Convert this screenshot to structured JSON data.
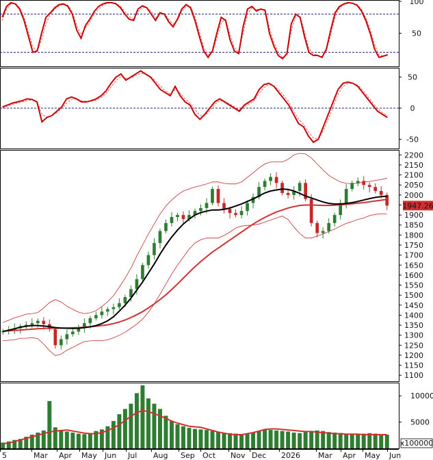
{
  "chart_data": [
    {
      "type": "line",
      "panel": "stochastic",
      "y_ticks": [
        "100",
        "50"
      ],
      "ylim": [
        0,
        100
      ],
      "reference_levels": [
        80,
        20
      ],
      "series": [
        {
          "color": "#cc0000",
          "values": [
            75,
            92,
            98,
            96,
            88,
            70,
            45,
            20,
            22,
            50,
            75,
            82,
            90,
            95,
            96,
            92,
            80,
            55,
            42,
            62,
            72,
            84,
            92,
            96,
            98,
            98,
            96,
            90,
            80,
            72,
            70,
            88,
            93,
            90,
            80,
            70,
            82,
            80,
            68,
            60,
            72,
            88,
            95,
            90,
            70,
            45,
            22,
            12,
            22,
            50,
            75,
            70,
            40,
            22,
            18,
            60,
            88,
            92,
            85,
            88,
            86,
            50,
            30,
            15,
            10,
            18,
            65,
            80,
            75,
            45,
            20,
            15,
            15,
            12,
            25,
            55,
            82,
            92,
            96,
            98,
            97,
            94,
            85,
            70,
            50,
            25,
            12,
            14,
            16
          ]
        },
        {
          "color": "#e06060",
          "values": [
            70,
            88,
            96,
            97,
            90,
            75,
            52,
            28,
            22,
            40,
            65,
            80,
            88,
            93,
            96,
            94,
            84,
            62,
            48,
            58,
            68,
            80,
            88,
            94,
            97,
            98,
            97,
            92,
            84,
            76,
            72,
            84,
            90,
            91,
            84,
            74,
            80,
            81,
            72,
            64,
            70,
            84,
            92,
            92,
            76,
            52,
            28,
            16,
            20,
            42,
            66,
            72,
            48,
            28,
            20,
            50,
            80,
            90,
            87,
            88,
            87,
            58,
            36,
            20,
            12,
            16,
            55,
            76,
            77,
            52,
            26,
            18,
            15,
            13,
            22,
            48,
            76,
            90,
            95,
            97,
            97,
            95,
            88,
            74,
            56,
            32,
            16,
            14,
            15
          ]
        }
      ]
    },
    {
      "type": "line",
      "panel": "macd",
      "y_ticks": [
        "50",
        "0",
        "-50"
      ],
      "ylim": [
        -65,
        65
      ],
      "reference_levels": [
        0
      ],
      "series": [
        {
          "color": "#cc0000",
          "values": [
            2,
            5,
            8,
            10,
            12,
            15,
            14,
            10,
            -22,
            -15,
            -12,
            -5,
            2,
            15,
            18,
            15,
            10,
            10,
            12,
            15,
            20,
            28,
            40,
            50,
            55,
            45,
            50,
            55,
            60,
            55,
            50,
            40,
            30,
            25,
            20,
            35,
            20,
            10,
            5,
            -10,
            -18,
            -10,
            0,
            10,
            15,
            10,
            5,
            0,
            -5,
            5,
            10,
            15,
            30,
            38,
            40,
            35,
            25,
            15,
            5,
            -10,
            -25,
            -30,
            -45,
            -55,
            -50,
            -30,
            -10,
            10,
            30,
            40,
            42,
            40,
            35,
            25,
            15,
            5,
            -5,
            -10,
            -15
          ]
        },
        {
          "color": "#e06060",
          "values": [
            0,
            3,
            6,
            8,
            10,
            12,
            13,
            11,
            -10,
            -14,
            -12,
            -7,
            -1,
            8,
            14,
            15,
            12,
            11,
            11,
            13,
            17,
            24,
            34,
            44,
            51,
            48,
            49,
            52,
            56,
            55,
            51,
            44,
            35,
            28,
            23,
            30,
            24,
            15,
            8,
            -2,
            -12,
            -12,
            -4,
            6,
            12,
            11,
            7,
            2,
            -3,
            2,
            7,
            12,
            24,
            33,
            38,
            36,
            29,
            20,
            10,
            -4,
            -18,
            -26,
            -38,
            -48,
            -49,
            -36,
            -18,
            2,
            22,
            35,
            40,
            40,
            37,
            29,
            19,
            9,
            -1,
            -7,
            -12
          ]
        }
      ]
    },
    {
      "type": "candlestick",
      "panel": "price",
      "x_labels": [
        "5",
        "Mar",
        "Apr",
        "May",
        "Jun",
        "Jul",
        "Aug",
        "Sep",
        "Oct",
        "Nov",
        "Dec",
        "2026",
        "Mar",
        "Apr",
        "May",
        "Jun"
      ],
      "y_ticks": [
        "2200",
        "2150",
        "2100",
        "2050",
        "2000",
        "1950",
        "1900",
        "1850",
        "1800",
        "1750",
        "1700",
        "1650",
        "1600",
        "1550",
        "1500",
        "1450",
        "1400",
        "1350",
        "1300",
        "1250",
        "1200",
        "1150",
        "1100"
      ],
      "ylim": [
        1070,
        2225
      ],
      "last_value_label": "1947.26",
      "close": [
        1320,
        1328,
        1335,
        1345,
        1352,
        1360,
        1372,
        1355,
        1330,
        1250,
        1280,
        1305,
        1318,
        1335,
        1360,
        1385,
        1400,
        1418,
        1430,
        1440,
        1460,
        1490,
        1530,
        1580,
        1650,
        1700,
        1760,
        1820,
        1860,
        1890,
        1900,
        1880,
        1900,
        1920,
        1935,
        1960,
        2030,
        1960,
        1930,
        1910,
        1900,
        1920,
        1960,
        1990,
        2040,
        2070,
        2090,
        2060,
        2010,
        2000,
        2020,
        2060,
        1980,
        1860,
        1810,
        1820,
        1860,
        1900,
        1960,
        2030,
        2060,
        2070,
        2050,
        2040,
        2020,
        2000,
        1947
      ],
      "ma_black": [
        1318,
        1325,
        1332,
        1340,
        1345,
        1348,
        1348,
        1346,
        1343,
        1338,
        1336,
        1335,
        1334,
        1335,
        1338,
        1342,
        1348,
        1358,
        1372,
        1392,
        1420,
        1450,
        1485,
        1525,
        1565,
        1610,
        1655,
        1705,
        1750,
        1790,
        1825,
        1855,
        1880,
        1900,
        1912,
        1920,
        1925,
        1925,
        1928,
        1935,
        1945,
        1955,
        1968,
        1980,
        1995,
        2010,
        2020,
        2025,
        2030,
        2028,
        2020,
        2008,
        1995,
        1985,
        1975,
        1965,
        1958,
        1955,
        1955,
        1958,
        1962,
        1968,
        1975,
        1982,
        1988,
        1992,
        1994
      ],
      "ma_red": [
        1320,
        1322,
        1324,
        1326,
        1328,
        1330,
        1332,
        1334,
        1335,
        1335,
        1336,
        1336,
        1337,
        1338,
        1340,
        1342,
        1345,
        1348,
        1352,
        1358,
        1366,
        1376,
        1388,
        1402,
        1418,
        1436,
        1456,
        1478,
        1502,
        1528,
        1556,
        1585,
        1614,
        1642,
        1668,
        1692,
        1715,
        1735,
        1755,
        1775,
        1795,
        1815,
        1835,
        1855,
        1872,
        1888,
        1902,
        1915,
        1925,
        1935,
        1942,
        1948,
        1950,
        1950,
        1949,
        1948,
        1948,
        1949,
        1951,
        1953,
        1956,
        1959,
        1962,
        1966,
        1970,
        1974,
        1978
      ],
      "bb_width": [
        45,
        50,
        55,
        55,
        60,
        60,
        65,
        90,
        120,
        140,
        130,
        110,
        95,
        80,
        70,
        70,
        75,
        85,
        95,
        105,
        120,
        135,
        150,
        170,
        185,
        195,
        200,
        200,
        195,
        185,
        175,
        165,
        150,
        140,
        135,
        135,
        140,
        140,
        130,
        120,
        110,
        110,
        120,
        130,
        140,
        145,
        145,
        140,
        135,
        150,
        180,
        200,
        210,
        200,
        180,
        160,
        140,
        125,
        110,
        100,
        95,
        90,
        90,
        85,
        85,
        85,
        90
      ]
    },
    {
      "type": "bar",
      "panel": "volume",
      "y_ticks": [
        "10000",
        "5000"
      ],
      "ylim": [
        0,
        12500
      ],
      "unit_label": "x100000",
      "values": [
        1100,
        1300,
        1600,
        1800,
        2200,
        2600,
        3000,
        3400,
        9000,
        4000,
        3500,
        3200,
        3000,
        2800,
        2700,
        2900,
        3300,
        3600,
        4200,
        5200,
        6500,
        7500,
        8500,
        10500,
        12000,
        9500,
        8500,
        7500,
        6200,
        5200,
        4600,
        4200,
        3900,
        3700,
        3600,
        3500,
        3300,
        3200,
        3000,
        2900,
        2800,
        2700,
        2800,
        3000,
        3300,
        3600,
        3500,
        3400,
        3300,
        3200,
        3000,
        2900,
        3100,
        3300,
        3400,
        3300,
        3100,
        3000,
        2900,
        2800,
        2700,
        2700,
        2800,
        2900,
        2800,
        2700,
        2600
      ],
      "ma_values": [
        900,
        1000,
        1300,
        1600,
        1900,
        2200,
        2500,
        2800,
        3100,
        3300,
        3400,
        3500,
        3300,
        3100,
        2900,
        2800,
        2800,
        3000,
        3400,
        3900,
        4500,
        5300,
        6100,
        6800,
        7200,
        7000,
        6600,
        6200,
        5700,
        5200,
        4800,
        4500,
        4200,
        4100,
        4000,
        3700,
        3400,
        3100,
        2900,
        2700,
        2600,
        2600,
        2800,
        3000,
        3300,
        3600,
        3700,
        3700,
        3600,
        3500,
        3400,
        3300,
        3200,
        3200,
        3100,
        3000,
        2900,
        2800,
        2800,
        2700,
        2700,
        2700,
        2600,
        2600,
        2600,
        2600,
        2600
      ]
    }
  ]
}
